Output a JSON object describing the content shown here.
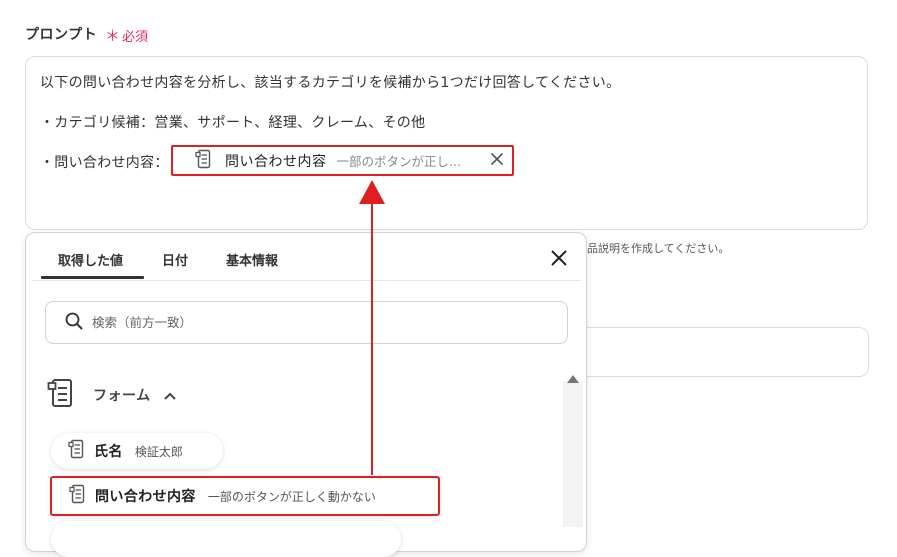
{
  "field": {
    "label": "プロンプト",
    "required_mark": "＊",
    "required_text": "必須"
  },
  "prompt": {
    "line1": "以下の問い合わせ内容を分析し、該当するカテゴリを候補から1つだけ回答してください。",
    "line2": "・カテゴリ候補：営業、サポート、経理、クレーム、その他",
    "line3": "・問い合わせ内容：",
    "chip_title": "問い合わせ内容",
    "chip_value": "一部のボタンが正し..."
  },
  "helper_text": "品説明を作成してください。",
  "popup": {
    "tabs": [
      "取得した値",
      "日付",
      "基本情報"
    ],
    "search_placeholder": "検索（前方一致）",
    "group_label": "フォーム",
    "items": [
      {
        "title": "氏名",
        "value": "検証太郎"
      },
      {
        "title": "問い合わせ内容",
        "value": "一部のボタンが正しく動かない"
      }
    ]
  },
  "colors": {
    "highlight": "#e02020",
    "required": "#e6335a"
  }
}
